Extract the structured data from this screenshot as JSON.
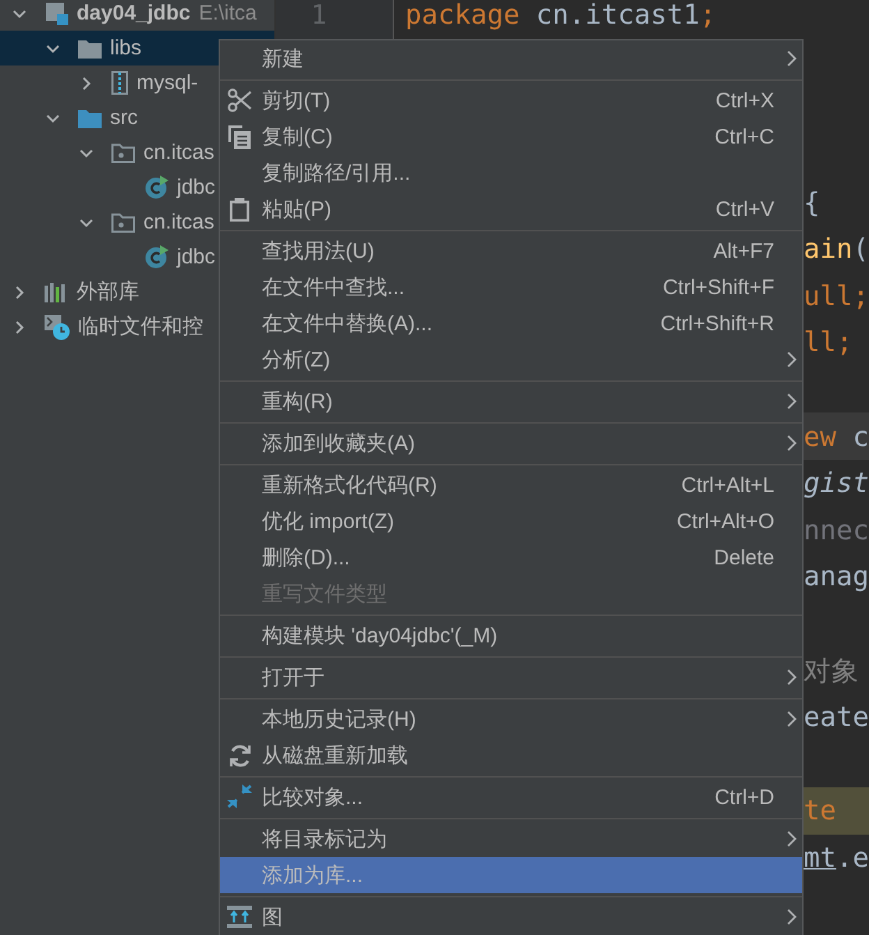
{
  "project_tree": [
    {
      "label": "day04_jdbc",
      "path": "E:\\itca",
      "kind": "module",
      "expanded": true,
      "selected": false,
      "children": [
        {
          "label": "libs",
          "kind": "folder",
          "expanded": true,
          "selected": true,
          "children": [
            {
              "label": "mysql-",
              "kind": "jar",
              "expanded": false,
              "selected": false
            }
          ]
        },
        {
          "label": "src",
          "kind": "source-folder",
          "expanded": true,
          "selected": false,
          "children": [
            {
              "label": "cn.itcas",
              "kind": "package",
              "expanded": true,
              "selected": false,
              "children": [
                {
                  "label": "jdbc",
                  "kind": "class",
                  "selected": false
                }
              ]
            },
            {
              "label": "cn.itcas",
              "kind": "package",
              "expanded": true,
              "selected": false,
              "children": [
                {
                  "label": "jdbc",
                  "kind": "class",
                  "selected": false
                }
              ]
            }
          ]
        }
      ]
    },
    {
      "label": "外部库",
      "kind": "libraries",
      "expanded": false,
      "selected": false
    },
    {
      "label": "临时文件和控",
      "kind": "scratches",
      "expanded": false,
      "selected": false
    }
  ],
  "editor": {
    "line_number": "1",
    "lines": [
      {
        "kind": "code",
        "caret_line": false,
        "usage_highlight": false,
        "tokens": [
          {
            "text": "package",
            "kind": "keyword"
          },
          {
            "text": " cn.itcast1",
            "kind": "plain"
          },
          {
            "text": ";",
            "kind": "keyword"
          }
        ]
      },
      {
        "kind": "blank",
        "caret_line": false,
        "usage_highlight": false
      },
      {
        "kind": "blank",
        "caret_line": false,
        "usage_highlight": false
      },
      {
        "kind": "blank",
        "caret_line": false,
        "usage_highlight": false
      },
      {
        "kind": "fragment",
        "caret_line": false,
        "usage_highlight": false,
        "tokens": [
          {
            "text": "{",
            "kind": "plain"
          }
        ]
      },
      {
        "kind": "fragment",
        "caret_line": false,
        "usage_highlight": false,
        "tokens": [
          {
            "text": "ain",
            "kind": "method"
          },
          {
            "text": "(",
            "kind": "plain"
          }
        ]
      },
      {
        "kind": "fragment",
        "caret_line": false,
        "usage_highlight": false,
        "tokens": [
          {
            "text": "ull;",
            "kind": "keyword"
          }
        ]
      },
      {
        "kind": "fragment",
        "caret_line": false,
        "usage_highlight": false,
        "tokens": [
          {
            "text": "ll;",
            "kind": "keyword"
          }
        ]
      },
      {
        "kind": "blank",
        "caret_line": false,
        "usage_highlight": false
      },
      {
        "kind": "fragment",
        "caret_line": true,
        "usage_highlight": false,
        "tokens": [
          {
            "text": "ew",
            "kind": "keyword"
          },
          {
            "text": " c",
            "kind": "plain"
          }
        ]
      },
      {
        "kind": "fragment",
        "caret_line": false,
        "usage_highlight": false,
        "tokens": [
          {
            "text": "gist",
            "kind": "static"
          }
        ]
      },
      {
        "kind": "fragment",
        "caret_line": false,
        "usage_highlight": false,
        "tokens": [
          {
            "text": "nnec",
            "kind": "unused"
          }
        ]
      },
      {
        "kind": "fragment",
        "caret_line": false,
        "usage_highlight": false,
        "tokens": [
          {
            "text": "anag",
            "kind": "plain"
          }
        ]
      },
      {
        "kind": "blank",
        "caret_line": false,
        "usage_highlight": false
      },
      {
        "kind": "fragment",
        "caret_line": false,
        "usage_highlight": false,
        "tokens": [
          {
            "text": "对象",
            "kind": "comment"
          }
        ]
      },
      {
        "kind": "fragment",
        "caret_line": false,
        "usage_highlight": false,
        "tokens": [
          {
            "text": "eate",
            "kind": "plain"
          }
        ]
      },
      {
        "kind": "blank",
        "caret_line": false,
        "usage_highlight": false
      },
      {
        "kind": "fragment",
        "caret_line": false,
        "usage_highlight": true,
        "tokens": [
          {
            "text": "te",
            "kind": "keyword"
          }
        ]
      },
      {
        "kind": "fragment",
        "caret_line": false,
        "usage_highlight": false,
        "tokens": [
          {
            "text": "mt",
            "kind": "linked"
          },
          {
            "text": ".e",
            "kind": "plain"
          }
        ]
      }
    ]
  },
  "context_menu": {
    "groups": [
      {
        "items": [
          {
            "label": "新建",
            "submenu": true,
            "disabled": false,
            "selected": false
          }
        ]
      },
      {
        "items": [
          {
            "label": "剪切(T)",
            "kind": "scissors",
            "shortcut": "Ctrl+X",
            "submenu": false,
            "disabled": false,
            "selected": false
          },
          {
            "label": "复制(C)",
            "kind": "copy",
            "shortcut": "Ctrl+C",
            "submenu": false,
            "disabled": false,
            "selected": false
          },
          {
            "label": "复制路径/引用...",
            "submenu": false,
            "disabled": false,
            "selected": false
          },
          {
            "label": "粘贴(P)",
            "kind": "clipboard",
            "shortcut": "Ctrl+V",
            "submenu": false,
            "disabled": false,
            "selected": false
          }
        ]
      },
      {
        "items": [
          {
            "label": "查找用法(U)",
            "shortcut": "Alt+F7",
            "submenu": false,
            "disabled": false,
            "selected": false
          },
          {
            "label": "在文件中查找...",
            "shortcut": "Ctrl+Shift+F",
            "submenu": false,
            "disabled": false,
            "selected": false
          },
          {
            "label": "在文件中替换(A)...",
            "shortcut": "Ctrl+Shift+R",
            "submenu": false,
            "disabled": false,
            "selected": false
          },
          {
            "label": "分析(Z)",
            "submenu": true,
            "disabled": false,
            "selected": false
          }
        ]
      },
      {
        "items": [
          {
            "label": "重构(R)",
            "submenu": true,
            "disabled": false,
            "selected": false
          }
        ]
      },
      {
        "items": [
          {
            "label": "添加到收藏夹(A)",
            "submenu": true,
            "disabled": false,
            "selected": false
          }
        ]
      },
      {
        "items": [
          {
            "label": "重新格式化代码(R)",
            "shortcut": "Ctrl+Alt+L",
            "submenu": false,
            "disabled": false,
            "selected": false
          },
          {
            "label": "优化 import(Z)",
            "shortcut": "Ctrl+Alt+O",
            "submenu": false,
            "disabled": false,
            "selected": false
          },
          {
            "label": "删除(D)...",
            "shortcut": "Delete",
            "submenu": false,
            "disabled": false,
            "selected": false
          },
          {
            "label": "重写文件类型",
            "submenu": false,
            "disabled": true,
            "selected": false
          }
        ]
      },
      {
        "items": [
          {
            "label": "构建模块 'day04jdbc'(_M)",
            "submenu": false,
            "disabled": false,
            "selected": false
          }
        ]
      },
      {
        "items": [
          {
            "label": "打开于",
            "submenu": true,
            "disabled": false,
            "selected": false
          }
        ]
      },
      {
        "items": [
          {
            "label": "本地历史记录(H)",
            "submenu": true,
            "disabled": false,
            "selected": false
          },
          {
            "label": "从磁盘重新加载",
            "kind": "reload",
            "submenu": false,
            "disabled": false,
            "selected": false
          }
        ]
      },
      {
        "items": [
          {
            "label": "比较对象...",
            "kind": "compare",
            "shortcut": "Ctrl+D",
            "submenu": false,
            "disabled": false,
            "selected": false
          }
        ]
      },
      {
        "items": [
          {
            "label": "将目录标记为",
            "submenu": true,
            "disabled": false,
            "selected": false
          },
          {
            "label": "添加为库...",
            "submenu": false,
            "disabled": false,
            "selected": true
          }
        ]
      },
      {
        "items": [
          {
            "label": "图",
            "kind": "diagram",
            "submenu": true,
            "disabled": false,
            "selected": false
          }
        ]
      }
    ]
  }
}
